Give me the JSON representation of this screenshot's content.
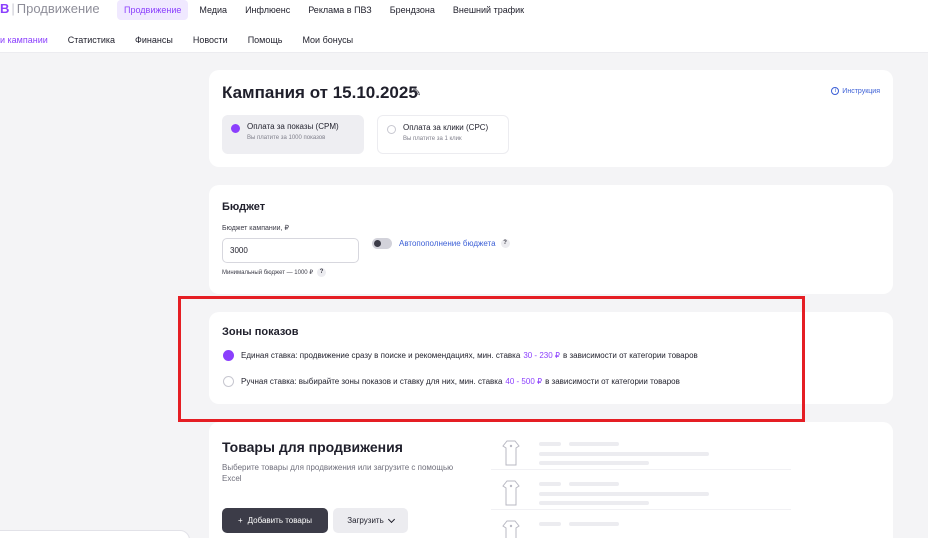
{
  "header": {
    "logo_letter": "B",
    "logo_text": "Продвижение",
    "nav": [
      "Продвижение",
      "Медиа",
      "Инфлюенс",
      "Реклама в ПВЗ",
      "Брендзона",
      "Внешний трафик"
    ],
    "active_nav": "Продвижение"
  },
  "subnav": {
    "items": [
      "и кампании",
      "Статистика",
      "Финансы",
      "Новости",
      "Помощь",
      "Мои бонусы"
    ],
    "active": "и кампании"
  },
  "campaign": {
    "title": "Кампания от 15.10.2025",
    "help_link": "Инструкция",
    "options": [
      {
        "title": "Оплата за показы (CPM)",
        "subtitle": "Вы платите за 1000 показов",
        "selected": true
      },
      {
        "title": "Оплата за клики (CPC)",
        "subtitle": "Вы платите за 1 клик",
        "selected": false
      }
    ]
  },
  "budget": {
    "title": "Бюджет",
    "field_label": "Бюджет кампании, ₽",
    "value": "3000",
    "min_hint": "Минимальный бюджет — 1000 ₽",
    "auto_refill_label": "Автопополнение бюджета",
    "auto_refill_on": false
  },
  "zones": {
    "title": "Зоны показов",
    "options": [
      {
        "text_before": "Единая ставка: продвижение сразу в поиске и рекомендациях, мин. ставка",
        "price": "30 - 230 ₽",
        "text_after": "в зависимости от категории товаров",
        "selected": true
      },
      {
        "text_before": "Ручная ставка: выбирайте зоны показов и ставку для них, мин. ставка",
        "price": "40 - 500 ₽",
        "text_after": "в зависимости от категории товаров",
        "selected": false
      }
    ]
  },
  "goods": {
    "title": "Товары для продвижения",
    "description": "Выберите товары для продвижения или загрузите с помощью Excel",
    "add_button": "Добавить товары",
    "add_icon": "+",
    "upload_button": "Загрузить"
  },
  "colors": {
    "accent": "#8b3ffd",
    "link": "#3b5fd6",
    "highlight_border": "#e51e24",
    "dark_button": "#3c3c48"
  },
  "icons": {
    "edit": "pencil-icon",
    "help": "info-circle-icon",
    "question": "question-mark-icon",
    "chevron": "chevron-down-icon",
    "product": "shirt-placeholder-icon"
  }
}
